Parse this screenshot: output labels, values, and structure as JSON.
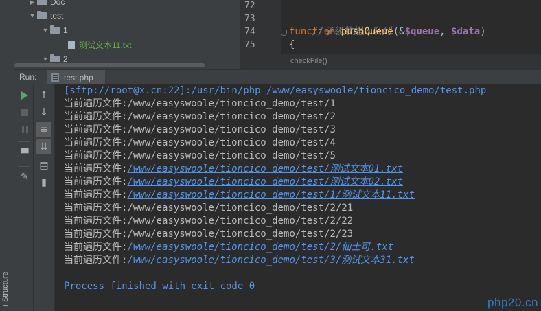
{
  "tree": {
    "items": [
      {
        "label": "Doc",
        "type": "folder",
        "expanded": false
      },
      {
        "label": "test",
        "type": "folder",
        "expanded": true
      },
      {
        "label": "1",
        "type": "folder",
        "expanded": true
      },
      {
        "label": "测试文本11.txt",
        "type": "file"
      },
      {
        "label": "2",
        "type": "folder",
        "expanded": true
      }
    ]
  },
  "editor": {
    "lines": [
      {
        "num": "72"
      },
      {
        "num": "73",
        "comment": "//子级数据入队列"
      },
      {
        "num": "74",
        "keyword": "function",
        "fn": "pushQueue",
        "p1": "(&",
        "v1": "$queue",
        "p2": ", ",
        "v2": "$data",
        "p3": ")"
      },
      {
        "num": "75",
        "text": "{"
      }
    ],
    "breadcrumb": "checkFile()"
  },
  "run": {
    "label": "Run:",
    "tab": "test.php"
  },
  "structure_label": "Structure",
  "console": {
    "command": "[sftp://root@x.cn:22]:/usr/bin/php /www/easyswoole/tioncico_demo/test.php",
    "prefix": "当前遍历文件:",
    "lines": [
      {
        "path": "/www/easyswoole/tioncico_demo/test/1",
        "link": false
      },
      {
        "path": "/www/easyswoole/tioncico_demo/test/2",
        "link": false
      },
      {
        "path": "/www/easyswoole/tioncico_demo/test/3",
        "link": false
      },
      {
        "path": "/www/easyswoole/tioncico_demo/test/4",
        "link": false
      },
      {
        "path": "/www/easyswoole/tioncico_demo/test/5",
        "link": false
      },
      {
        "path": "/www/easyswoole/tioncico_demo/test/测试文本01.txt",
        "link": true
      },
      {
        "path": "/www/easyswoole/tioncico_demo/test/测试文本02.txt",
        "link": true
      },
      {
        "path": "/www/easyswoole/tioncico_demo/test/1/测试文本11.txt",
        "link": true
      },
      {
        "path": "/www/easyswoole/tioncico_demo/test/2/21",
        "link": false
      },
      {
        "path": "/www/easyswoole/tioncico_demo/test/2/22",
        "link": false
      },
      {
        "path": "/www/easyswoole/tioncico_demo/test/2/23",
        "link": false
      },
      {
        "path": "/www/easyswoole/tioncico_demo/test/2/仙士可.txt",
        "link": true
      },
      {
        "path": "/www/easyswoole/tioncico_demo/test/3/测试文本31.txt",
        "link": true
      }
    ],
    "exit": "Process finished with exit code 0"
  },
  "watermark": "php20.cn",
  "colors": {
    "background": "#2b2b2b",
    "panel": "#3c3f41",
    "link": "#5394ec",
    "keyword": "#cc7832",
    "function": "#ffc66d",
    "variable": "#9876aa",
    "run_green": "#59a869"
  }
}
